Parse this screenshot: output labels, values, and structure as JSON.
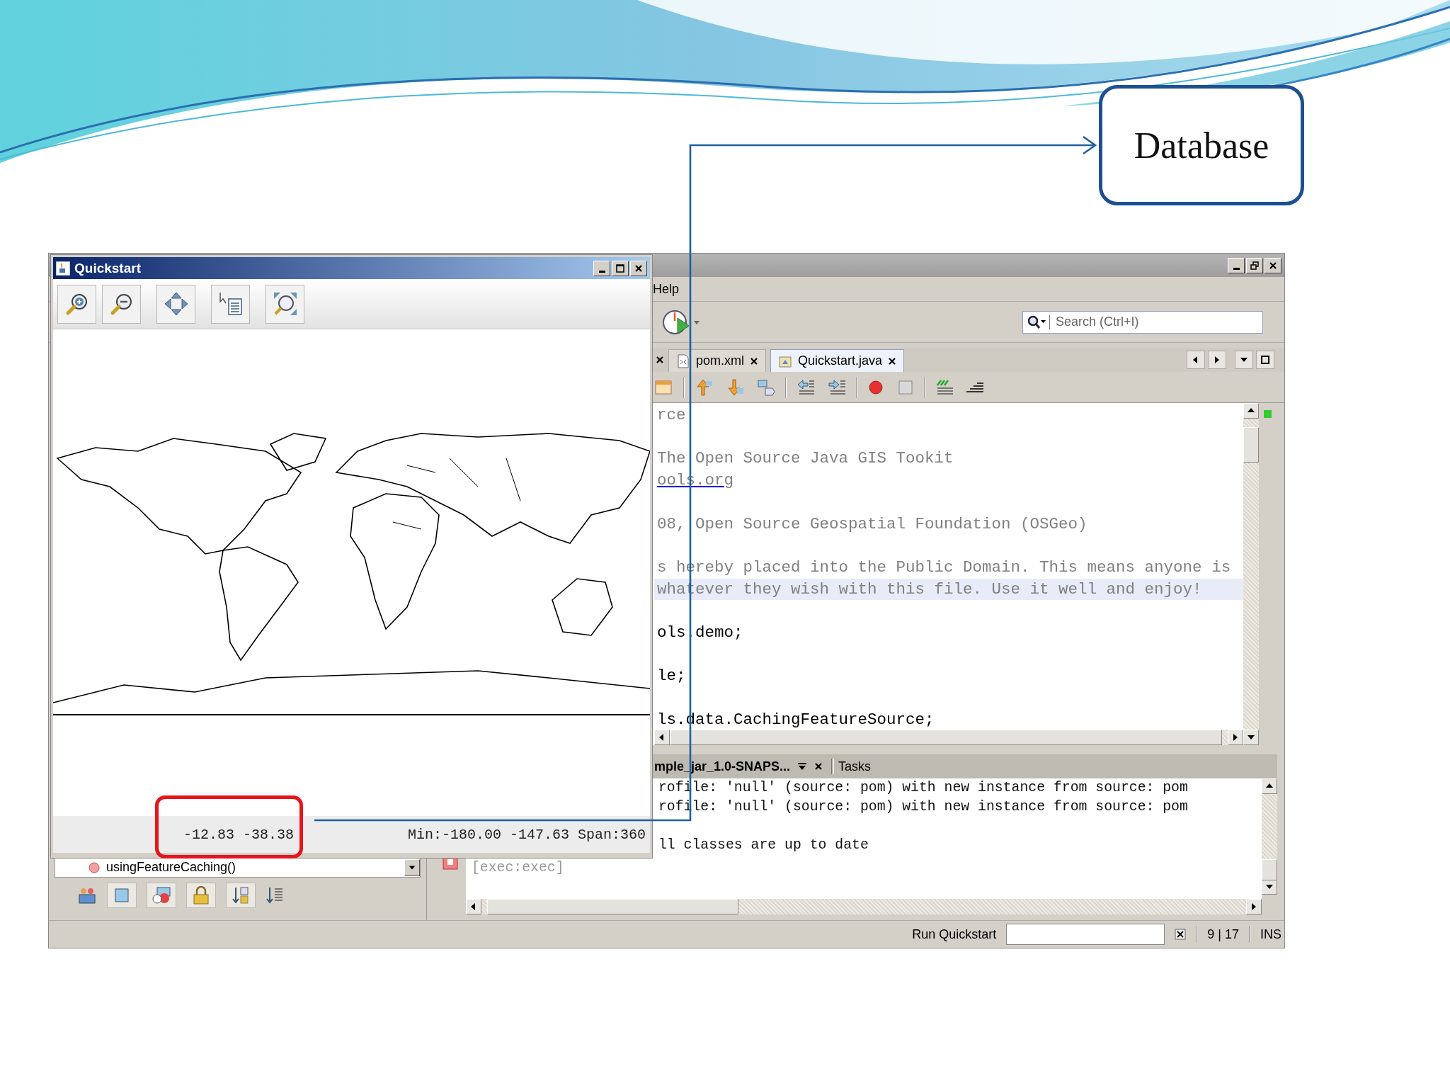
{
  "slide": {
    "callout": "Database"
  },
  "quickstart": {
    "title": "Quickstart",
    "status": {
      "cursor": "-12.83 -38.38",
      "extent": "Min:-180.00 -147.63 Span:360"
    }
  },
  "ide": {
    "menu": [
      "Help"
    ],
    "search": {
      "placeholder": "Search (Ctrl+I)"
    },
    "tabs": [
      {
        "label": "pom.xml",
        "selected": false
      },
      {
        "label": "Quickstart.java",
        "selected": true
      }
    ],
    "editor": {
      "lines": [
        {
          "kind": "comment",
          "text": "rce",
          "highlighted": false
        },
        {
          "kind": "comment",
          "text": "The Open Source Java GIS Tookit",
          "highlighted": false
        },
        {
          "kind": "link",
          "text": "ools.org",
          "highlighted": false
        },
        {
          "kind": "comment",
          "text": "08, Open Source Geospatial Foundation (OSGeo)",
          "highlighted": false
        },
        {
          "kind": "comment",
          "text": "s hereby placed into the Public Domain. This means anyone is",
          "highlighted": false
        },
        {
          "kind": "comment",
          "text": "whatever they wish with this file. Use it well and enjoy!",
          "highlighted": true
        },
        {
          "kind": "code",
          "text": "ols.demo;",
          "highlighted": false
        },
        {
          "kind": "code",
          "text": "le;",
          "highlighted": false
        },
        {
          "kind": "code",
          "text": "ls.data.CachingFeatureSource;",
          "highlighted": false
        }
      ]
    },
    "output": {
      "tabs": [
        {
          "label": "mple_jar_1.0-SNAPS...",
          "selected": true
        },
        {
          "label": "Tasks",
          "selected": false
        }
      ],
      "lines": [
        "rofile: 'null' (source: pom) with new instance from source: pom",
        "rofile: 'null' (source: pom) with new instance from source: pom",
        "ll classes are up to date"
      ],
      "exec_line": "[exec:exec]"
    },
    "navigator": {
      "item": "usingFeatureCaching()"
    },
    "status_bar": {
      "task": "Run Quickstart",
      "position": "9 | 17",
      "mode": "INS"
    }
  }
}
